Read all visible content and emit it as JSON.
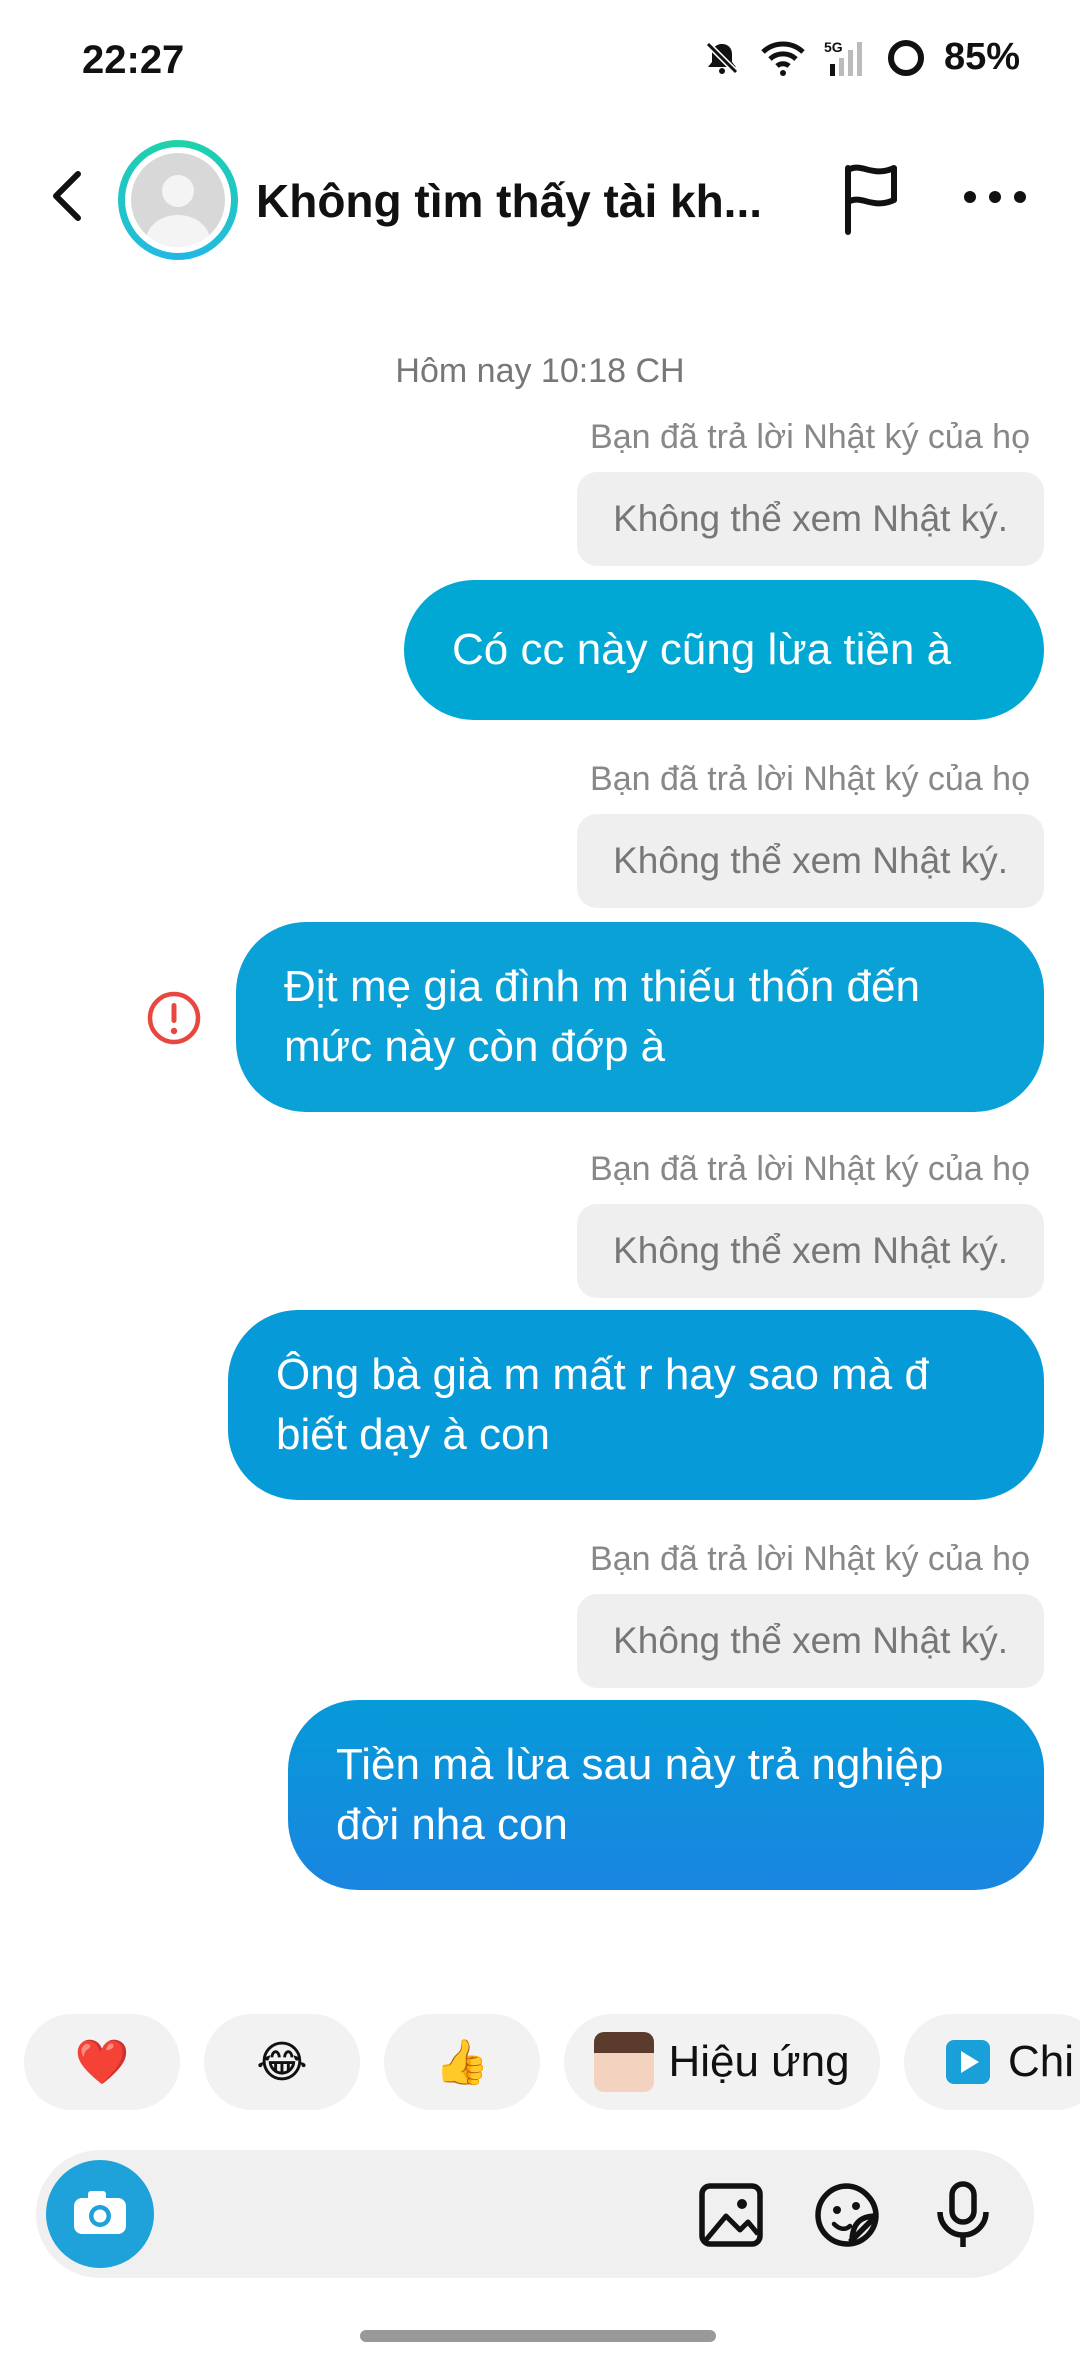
{
  "status_bar": {
    "time": "22:27",
    "network": "5G",
    "battery": "85%"
  },
  "header": {
    "title": "Không tìm thấy tài kh..."
  },
  "chat": {
    "date": "Hôm nay 10:18 CH",
    "items": [
      {
        "note": "Bạn đã trả lời Nhật ký của họ",
        "story": "Không thể xem Nhật ký.",
        "message": "Có cc này cũng lừa tiền à"
      },
      {
        "note": "Bạn đã trả lời Nhật ký của họ",
        "story": "Không thể xem Nhật ký.",
        "message_line1": "Địt mẹ gia đình m thiếu thốn đến",
        "message_line2": "mức này còn đớp à",
        "failed": true
      },
      {
        "note": "Bạn đã trả lời Nhật ký của họ",
        "story": "Không thể xem Nhật ký.",
        "message_line1": "Ông bà già m mất r hay sao mà đ",
        "message_line2": "biết dạy à con"
      },
      {
        "note": "Bạn đã trả lời Nhật ký của họ",
        "story": "Không thể xem Nhật ký.",
        "message_line1": "Tiền mà lừa sau này trả nghiệp",
        "message_line2": "đời nha con"
      }
    ]
  },
  "reactions": {
    "heart": "❤️",
    "laugh": "😂",
    "thumbs": "👍",
    "effect_label": "Hiệu ứng",
    "video_label": "Chi"
  },
  "colors": {
    "accent": "#00a8d3",
    "error": "#e8473f"
  }
}
